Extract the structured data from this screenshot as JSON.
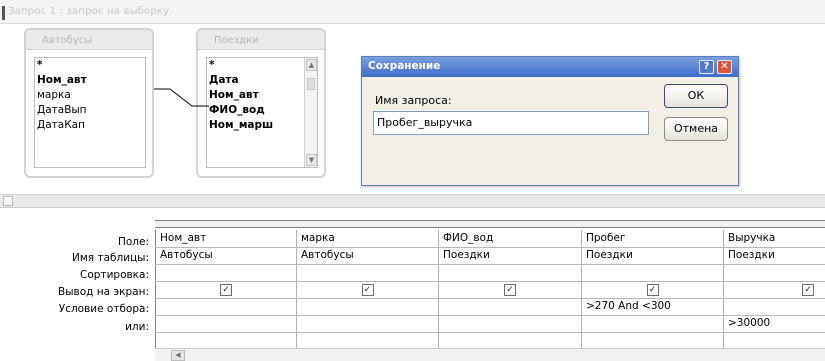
{
  "window": {
    "title": "Запрос 1 : запрос на выборку"
  },
  "tables": [
    {
      "name": "Автобусы",
      "fields": [
        {
          "label": "*",
          "bold": true
        },
        {
          "label": "Ном_авт",
          "bold": true
        },
        {
          "label": "марка",
          "bold": false
        },
        {
          "label": "ДатаВып",
          "bold": false
        },
        {
          "label": "ДатаКап",
          "bold": false
        }
      ]
    },
    {
      "name": "Поездки",
      "fields": [
        {
          "label": "*",
          "bold": true
        },
        {
          "label": "Дата",
          "bold": true
        },
        {
          "label": "Ном_авт",
          "bold": true
        },
        {
          "label": "ФИО_вод",
          "bold": true
        },
        {
          "label": "Ном_марш",
          "bold": true
        }
      ]
    }
  ],
  "dialog": {
    "title": "Сохранение",
    "help_glyph": "?",
    "close_glyph": "✕",
    "query_name_label": "Имя запроса:",
    "query_name_value": "Пробег_выручка",
    "ok_label": "ОК",
    "cancel_label": "Отмена"
  },
  "grid": {
    "row_labels": {
      "field": "Поле:",
      "table": "Имя таблицы:",
      "sort": "Сортировка:",
      "show": "Вывод на экран:",
      "criteria": "Условие отбора:",
      "or": "или:"
    },
    "columns": [
      {
        "field": "Ном_авт",
        "table": "Автобусы",
        "sort": "",
        "show": true,
        "criteria": "",
        "or": ""
      },
      {
        "field": "марка",
        "table": "Автобусы",
        "sort": "",
        "show": true,
        "criteria": "",
        "or": ""
      },
      {
        "field": "ФИО_вод",
        "table": "Поездки",
        "sort": "",
        "show": true,
        "criteria": "",
        "or": ""
      },
      {
        "field": "Пробег",
        "table": "Поездки",
        "sort": "",
        "show": true,
        "criteria": ">270 And <300",
        "or": ""
      },
      {
        "field": "Выручка",
        "table": "Поездки",
        "sort": "",
        "show": true,
        "criteria": "",
        "or": ">30000"
      }
    ],
    "check_glyph": "✓"
  }
}
